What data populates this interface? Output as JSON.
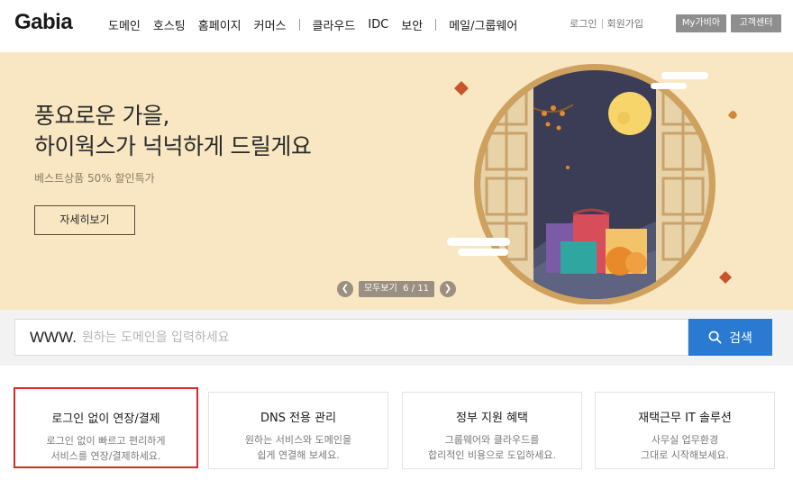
{
  "header": {
    "logo": "Gabia",
    "nav_group1": [
      "도메인",
      "호스팅",
      "홈페이지",
      "커머스"
    ],
    "nav_group2": [
      "클라우드",
      "IDC",
      "보안"
    ],
    "nav_group3": [
      "메일/그룹웨어"
    ],
    "login": "로그인",
    "signup": "회원가입",
    "mygabia": "My가비아",
    "support": "고객센터"
  },
  "banner": {
    "title_line1": "풍요로운 가을,",
    "title_line2": "하이웍스가 넉넉하게 드릴게요",
    "subtitle": "베스트상품 50% 할인특가",
    "detail_button": "자세히보기",
    "prev_icon": "chevron-left-icon",
    "next_icon": "chevron-right-icon",
    "view_all": "모두보기",
    "slide_counter": "6 / 11",
    "colors": {
      "background": "#f8e7c2",
      "night_sky": "#3b3f56",
      "moon": "#f7d56a"
    }
  },
  "search": {
    "prefix": "WWW.",
    "placeholder": "원하는 도메인을 입력하세요",
    "button_label": "검색",
    "button_icon": "search-icon",
    "accent": "#2a7ad2"
  },
  "cards": [
    {
      "title": "로그인 없이 연장/결제",
      "desc": [
        "로그인 없이 빠르고 편리하게",
        "서비스를 연장/결제하세요."
      ]
    },
    {
      "title": "DNS 전용 관리",
      "desc": [
        "원하는 서비스와 도메인을",
        "쉽게 연결해 보세요."
      ]
    },
    {
      "title": "정부 지원 혜택",
      "desc": [
        "그룹웨어와 클라우드를",
        "합리적인 비용으로 도입하세요."
      ]
    },
    {
      "title": "재택근무 IT 솔루션",
      "desc": [
        "사무실 업무환경",
        "그대로 시작해보세요."
      ]
    }
  ]
}
